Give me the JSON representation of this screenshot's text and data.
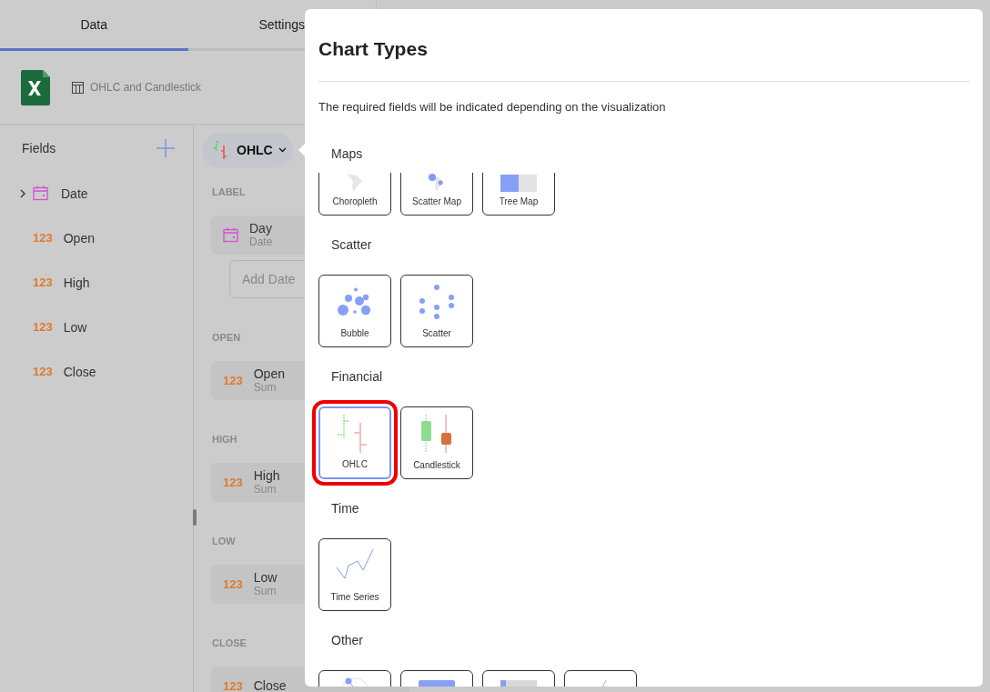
{
  "tabs": [
    {
      "label": "Data",
      "selected": true
    },
    {
      "label": "Settings",
      "selected": false
    }
  ],
  "data_source": {
    "kind": "excel",
    "sheet": "OHLC and Candlestick"
  },
  "fields": {
    "title": "Fields",
    "items": [
      {
        "label": "Date",
        "kind": "date",
        "expandable": true
      },
      {
        "label": "Open",
        "kind": "number",
        "badge": "123",
        "expandable": false
      },
      {
        "label": "High",
        "kind": "number",
        "badge": "123",
        "expandable": false
      },
      {
        "label": "Low",
        "kind": "number",
        "badge": "123",
        "expandable": false
      },
      {
        "label": "Close",
        "kind": "number",
        "badge": "123",
        "expandable": false
      }
    ]
  },
  "visualization": {
    "label": "OHLC"
  },
  "slots": [
    {
      "heading": "LABEL",
      "pill": {
        "name": "Day",
        "aggregation": "Date",
        "kind": "date"
      },
      "add_placeholder": "Add Date"
    },
    {
      "heading": "OPEN",
      "pill": {
        "name": "Open",
        "aggregation": "Sum",
        "kind": "number",
        "badge": "123"
      }
    },
    {
      "heading": "HIGH",
      "pill": {
        "name": "High",
        "aggregation": "Sum",
        "kind": "number",
        "badge": "123"
      }
    },
    {
      "heading": "LOW",
      "pill": {
        "name": "Low",
        "aggregation": "Sum",
        "kind": "number",
        "badge": "123"
      }
    },
    {
      "heading": "CLOSE",
      "pill": {
        "name": "Close",
        "kind": "number",
        "badge": "123"
      }
    }
  ],
  "dialog": {
    "title": "Chart Types",
    "subtitle": "The required fields will be indicated depending on the visualization",
    "sections": [
      {
        "title": "Maps",
        "items": [
          {
            "label": "Choropleth",
            "kind": "choropleth",
            "selected": false,
            "highlighted": false
          },
          {
            "label": "Scatter Map",
            "kind": "scatter-map",
            "selected": false,
            "highlighted": false
          },
          {
            "label": "Tree Map",
            "kind": "tree-map",
            "selected": false,
            "highlighted": false
          }
        ]
      },
      {
        "title": "Scatter",
        "items": [
          {
            "label": "Bubble",
            "kind": "bubble",
            "selected": false,
            "highlighted": false
          },
          {
            "label": "Scatter",
            "kind": "scatter",
            "selected": false,
            "highlighted": false
          }
        ]
      },
      {
        "title": "Financial",
        "items": [
          {
            "label": "OHLC",
            "kind": "ohlc",
            "selected": true,
            "highlighted": true
          },
          {
            "label": "Candlestick",
            "kind": "candlestick",
            "selected": false,
            "highlighted": false
          }
        ]
      },
      {
        "title": "Time",
        "items": [
          {
            "label": "Time Series",
            "kind": "time-series",
            "selected": false,
            "highlighted": false
          }
        ]
      },
      {
        "title": "Other",
        "items": [
          {
            "kind": "gauge",
            "selected": false,
            "highlighted": false
          },
          {
            "kind": "kpi",
            "selected": false,
            "highlighted": false
          },
          {
            "kind": "bullet",
            "selected": false,
            "highlighted": false
          },
          {
            "kind": "sparkline",
            "selected": false,
            "highlighted": false
          }
        ]
      }
    ]
  }
}
